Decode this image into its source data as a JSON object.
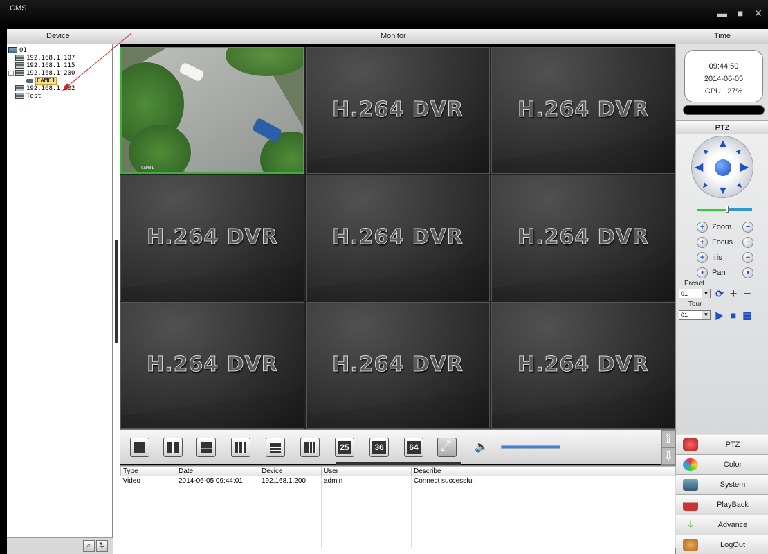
{
  "window": {
    "title": "CMS"
  },
  "headers": {
    "device": "Device",
    "monitor": "Monitor",
    "time": "Time"
  },
  "tree": {
    "root": "01",
    "devices": [
      "192.168.1.107",
      "192.168.1.115",
      "192.168.1.200",
      "CAM01",
      "192.168.1.202",
      "Test"
    ]
  },
  "tiles": {
    "placeholder": "H.264 DVR",
    "camera_label": "CAM01"
  },
  "clock": {
    "time": "09:44:50",
    "date": "2014-06-05",
    "cpu": "CPU : 27%"
  },
  "ptz": {
    "heading": "PTZ",
    "zoom": "Zoom",
    "focus": "Focus",
    "iris": "Iris",
    "pan": "Pan",
    "preset_label": "Preset",
    "preset_value": "01",
    "tour_label": "Tour",
    "tour_value": "01"
  },
  "menu": [
    "PTZ",
    "Color",
    "System",
    "PlayBack",
    "Advance",
    "LogOut"
  ],
  "layout_buttons": [
    "25",
    "36",
    "64"
  ],
  "volume_level": 1.0,
  "log": {
    "columns": [
      "Type",
      "Date",
      "Device",
      "User",
      "Describe"
    ],
    "rows": [
      [
        "Video",
        "2014-06-05 09:44:01",
        "192.168.1.200",
        "admin",
        "Connect successful"
      ]
    ]
  },
  "colors": {
    "active_border": "#3bb13b",
    "accent": "#1d4fc8"
  }
}
